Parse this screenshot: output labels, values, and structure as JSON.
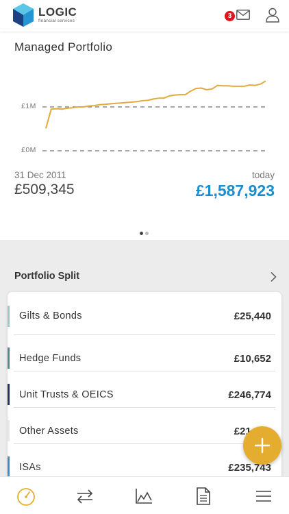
{
  "header": {
    "logo_name": "LOGIC",
    "logo_sub": "financial services",
    "unread_count": "3"
  },
  "portfolio": {
    "title": "Managed Portfolio",
    "start_date": "31 Dec 2011",
    "start_value": "£509,345",
    "end_date": "today",
    "end_value": "£1,587,923",
    "page_count": 2,
    "current_page": 1
  },
  "chart_data": {
    "type": "line",
    "title": "",
    "xlabel": "",
    "ylabel": "",
    "y_tick_labels": [
      "£0M",
      "£1M"
    ],
    "y_ticks": [
      0,
      1
    ],
    "ylim": [
      0,
      1.55
    ],
    "grid": "dashed lines at £0M and £1M",
    "color": "#e2aa3d",
    "series": [
      {
        "x": [
          0,
          1,
          2,
          3,
          4,
          5,
          6,
          7,
          8,
          9,
          10,
          11,
          12,
          13,
          14,
          15,
          16,
          17,
          18,
          19,
          20,
          21,
          22,
          23,
          24,
          25,
          26,
          27,
          28,
          29,
          30,
          31,
          32,
          33,
          34,
          35,
          36,
          37,
          38,
          39,
          40,
          41
        ],
        "values": [
          0.51,
          0.95,
          0.96,
          0.95,
          0.97,
          0.98,
          1.0,
          1.0,
          1.02,
          1.03,
          1.05,
          1.06,
          1.07,
          1.08,
          1.09,
          1.1,
          1.11,
          1.12,
          1.14,
          1.15,
          1.18,
          1.2,
          1.2,
          1.25,
          1.27,
          1.28,
          1.28,
          1.36,
          1.42,
          1.43,
          1.39,
          1.41,
          1.49,
          1.48,
          1.48,
          1.47,
          1.47,
          1.47,
          1.5,
          1.49,
          1.52,
          1.59
        ]
      }
    ]
  },
  "split": {
    "title": "Portfolio Split",
    "rows": [
      {
        "label": "Gilts & Bonds",
        "value": "£25,440",
        "color": "#9ec8c2"
      },
      {
        "label": "Hedge Funds",
        "value": "£10,652",
        "color": "#4f8d8c"
      },
      {
        "label": "Unit Trusts & OEICS",
        "value": "£246,774",
        "color": "#24325f"
      },
      {
        "label": "Other Assets",
        "value": "£21,000",
        "color": "#e8e8e8"
      },
      {
        "label": "ISAs",
        "value": "£235,743",
        "color": "#3d8ecb"
      }
    ]
  },
  "colors": {
    "accent": "#1b8ecd",
    "gold": "#e5ad2f",
    "badge": "#e0141e"
  },
  "nav": {
    "items": [
      "dashboard-icon",
      "transfer-icon",
      "chart-icon",
      "document-icon",
      "menu-icon"
    ]
  }
}
